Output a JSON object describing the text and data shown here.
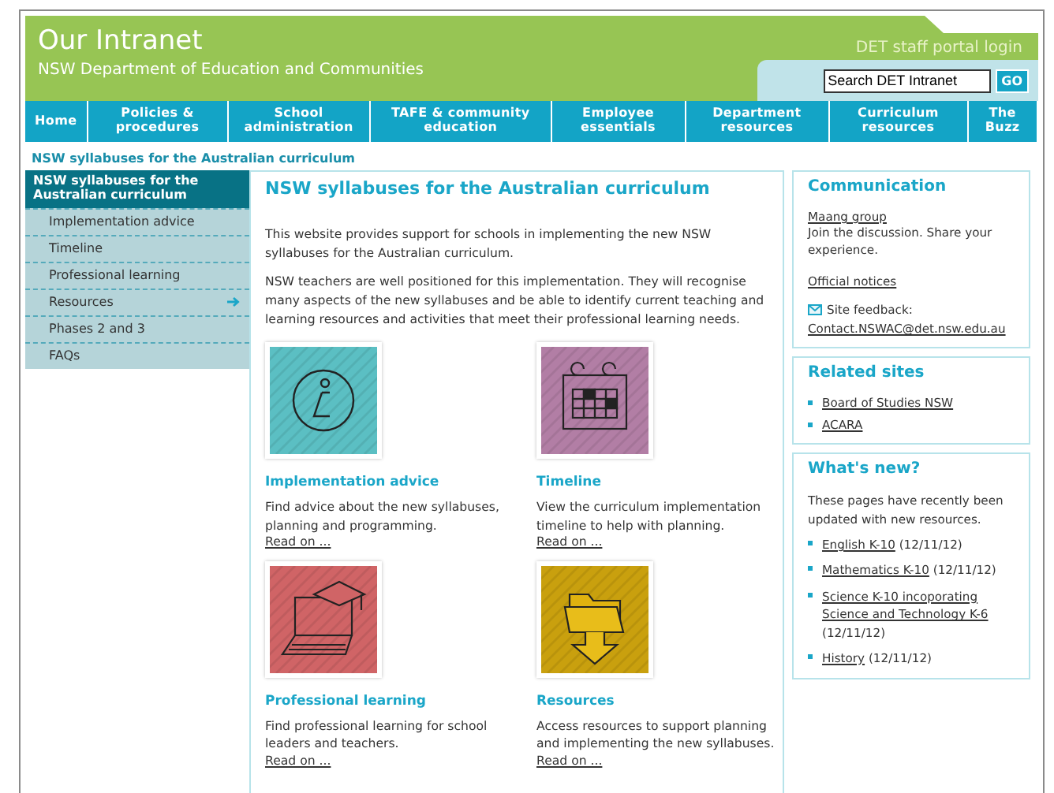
{
  "header": {
    "title": "Our Intranet",
    "subtitle": "NSW Department of Education and Communities",
    "portal_link": "DET staff portal login",
    "search": {
      "value": "Search DET Intranet",
      "button": "GO"
    }
  },
  "nav": [
    {
      "label": "Home"
    },
    {
      "label": "Policies & procedures"
    },
    {
      "label": "School administration"
    },
    {
      "label": "TAFE & community education"
    },
    {
      "label": "Employee essentials"
    },
    {
      "label": "Department resources"
    },
    {
      "label": "Curriculum resources"
    },
    {
      "label": "The Buzz"
    }
  ],
  "breadcrumb": "NSW syllabuses for the Australian curriculum",
  "sidebar": {
    "title": "NSW syllabuses for the Australian curriculum",
    "items": [
      {
        "label": "Implementation advice",
        "submenu": false
      },
      {
        "label": "Timeline",
        "submenu": false
      },
      {
        "label": "Professional learning",
        "submenu": false
      },
      {
        "label": "Resources",
        "submenu": true
      },
      {
        "label": "Phases 2 and 3",
        "submenu": false
      },
      {
        "label": "FAQs",
        "submenu": false
      }
    ]
  },
  "main": {
    "heading": "NSW syllabuses for the Australian curriculum",
    "paragraphs": [
      "This website provides support for schools in implementing the new NSW syllabuses for the Australian curriculum.",
      "NSW teachers are well positioned for this implementation. They will recognise many aspects of the new syllabuses and be able to identify current teaching and learning resources and activities that meet their professional learning needs."
    ],
    "cards": [
      {
        "kind": "info",
        "color": "#5bbfc3",
        "title": "Implementation advice",
        "text": "Find advice about the new syllabuses, planning and programming.",
        "link": "Read on ..."
      },
      {
        "kind": "calendar",
        "color": "#b27ea5",
        "title": "Timeline",
        "text": "View the curriculum implementation timeline to help with planning.",
        "link": "Read on ..."
      },
      {
        "kind": "laptop",
        "color": "#d06466",
        "title": "Professional learning",
        "text": "Find professional learning for school leaders and teachers.",
        "link": "Read on ..."
      },
      {
        "kind": "folder",
        "color": "#c9a00e",
        "title": "Resources",
        "text": "Access resources to support planning and implementing the new syllabuses.",
        "link": "Read on ..."
      }
    ]
  },
  "communication": {
    "title": "Communication",
    "group_link": "Maang group",
    "group_text": "Join the discussion. Share your experience.",
    "notices_link": "Official notices",
    "feedback_label": "Site feedback:",
    "feedback_email": "Contact.NSWAC@det.nsw.edu.au"
  },
  "related_sites": {
    "title": "Related sites",
    "links": [
      "Board of Studies NSW",
      "ACARA"
    ]
  },
  "whats_new": {
    "title": "What's new?",
    "intro": "These pages have recently been updated with new resources.",
    "items": [
      {
        "link": "English K-10",
        "date": "(12/11/12)"
      },
      {
        "link": "Mathematics K-10",
        "date": "(12/11/12)"
      },
      {
        "link": "Science K-10 incoporating Science and Technology K-6",
        "date": "(12/11/12)"
      },
      {
        "link": "History",
        "date": "(12/11/12)"
      }
    ]
  }
}
